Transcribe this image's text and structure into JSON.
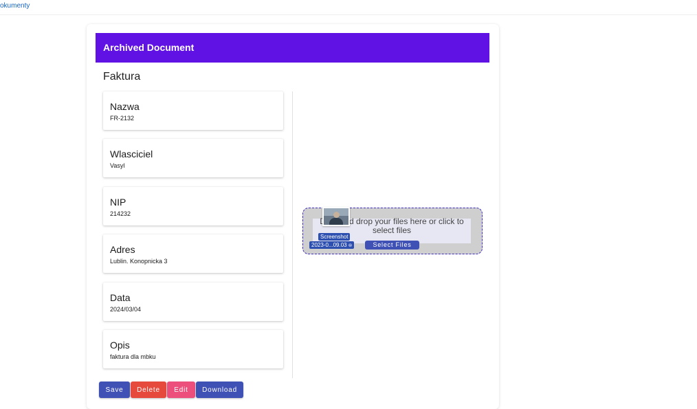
{
  "topbar": {
    "link_label": "okumenty"
  },
  "header": {
    "title": "Archived Document"
  },
  "document": {
    "type": "Faktura",
    "fields": [
      {
        "label": "Nazwa",
        "value": "FR-2132"
      },
      {
        "label": "Wlasciciel",
        "value": "Vasyl"
      },
      {
        "label": "NIP",
        "value": "214232"
      },
      {
        "label": "Adres",
        "value": "Lublin. Konopnicka 3"
      },
      {
        "label": "Data",
        "value": "2024/03/04"
      },
      {
        "label": "Opis",
        "value": "faktura dla mbku"
      }
    ]
  },
  "dropzone": {
    "text": "Drag and drop your files here or click to select files",
    "file_label": "Screenshot",
    "file_name": "2023-0...09.03",
    "select_label": "Select Files"
  },
  "actions": {
    "save_label": "Save",
    "delete_label": "Delete",
    "edit_label": "Edit",
    "download_label": "Download"
  },
  "colors": {
    "header": "#6012e4",
    "save": "#3f51b5",
    "delete": "#e64a3c",
    "edit": "#ec4f7c",
    "download": "#3f51b5"
  }
}
